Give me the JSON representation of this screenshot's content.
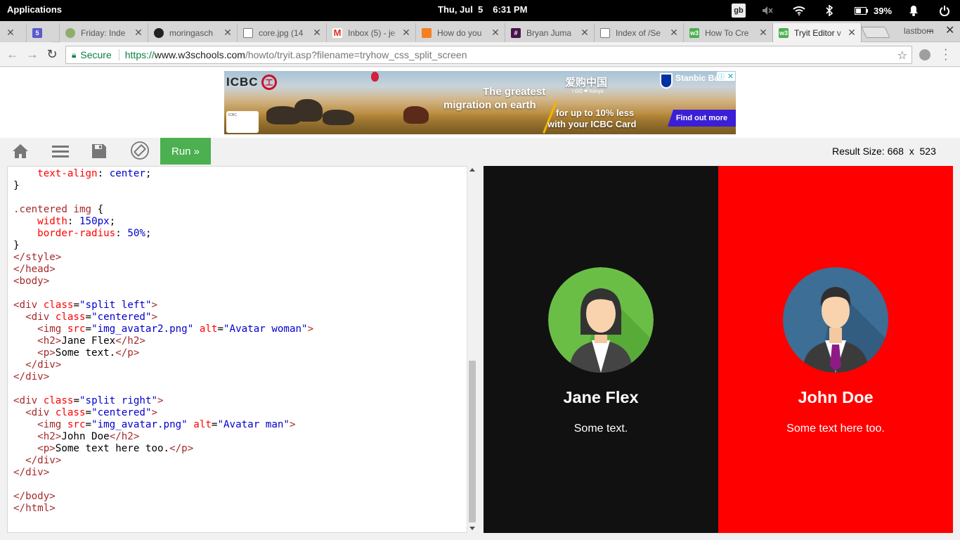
{
  "os": {
    "apps_label": "Applications",
    "day": "Thu, Jul  5",
    "time": "6:31 PM",
    "keyboard": "gb",
    "battery": "39%"
  },
  "browser": {
    "tabs": [
      {
        "title": "",
        "icon": "close-icon"
      },
      {
        "title": "",
        "icon": "five-icon"
      },
      {
        "title": "Friday: Inde",
        "icon": "tree-icon"
      },
      {
        "title": "moringasch",
        "icon": "github-icon"
      },
      {
        "title": "core.jpg (14",
        "icon": "page-icon"
      },
      {
        "title": "Inbox (5) - je",
        "icon": "gmail-icon"
      },
      {
        "title": "How do you",
        "icon": "stackoverflow-icon"
      },
      {
        "title": "Bryan Juma",
        "icon": "slack-hash-icon"
      },
      {
        "title": "Index of /Se",
        "icon": "page-icon"
      },
      {
        "title": "How To Cre",
        "icon": "w3schools-icon"
      },
      {
        "title": "Tryit Editor v",
        "icon": "w3schools-icon"
      }
    ],
    "profile": "lastborn",
    "url": {
      "secure_label": "Secure",
      "scheme": "https://",
      "host": "www.w3schools.com",
      "path": "/howto/tryit.asp?filename=tryhow_css_split_screen"
    }
  },
  "ad": {
    "brand": "ICBC",
    "headline_1": "The greatest",
    "headline_2": "migration on earth",
    "cn_text": "爱购中国",
    "cn_sub": "I GO ❤ Kenya",
    "offer_1": "for up to 10% less",
    "offer_2": "with your ICBC Card",
    "sponsor": "Stanbic Bank",
    "cta": "Find out more",
    "info": "ⓘ",
    "close": "✕"
  },
  "editor": {
    "run_label": "Run »",
    "result_size_label": "Result Size:",
    "result_w": "668",
    "result_x": "x",
    "result_h": "523"
  },
  "result": {
    "left": {
      "name": "Jane Flex",
      "text": "Some text."
    },
    "right": {
      "name": "John Doe",
      "text": "Some text here too."
    }
  },
  "colors": {
    "left_bg": "#111111",
    "right_bg": "#ff0000",
    "run_button": "#4caf50"
  }
}
